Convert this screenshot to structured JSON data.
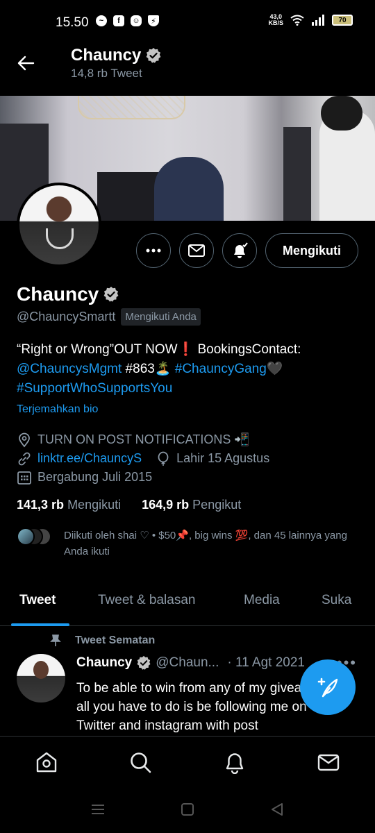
{
  "status_bar": {
    "time": "15.50",
    "net_speed_value": "43,0",
    "net_speed_unit": "KB/S",
    "battery": "70",
    "icons": [
      "messenger-icon",
      "facebook-icon",
      "app-icon",
      "shield-icon",
      "wifi-icon",
      "signal-icon",
      "battery-icon"
    ]
  },
  "header": {
    "name": "Chauncy",
    "tweet_count": "14,8 rb Tweet"
  },
  "profile": {
    "name": "Chauncy",
    "handle": "@ChauncySmartt",
    "follows_you": "Mengikuti Anda",
    "follow_button": "Mengikuti",
    "bio_part1": "“Right or Wrong”OUT NOW❗ BookingsContact: ",
    "bio_mention": "@ChauncysMgmt",
    "bio_part2": " #863🏝️ ",
    "bio_hashtag1": "#ChauncyGang",
    "bio_part3": "🖤 ",
    "bio_hashtag2": "#SupportWhoSupportsYou",
    "translate_bio": "Terjemahkan bio",
    "location": "TURN ON POST NOTIFICATIONS 📲",
    "website": "linktr.ee/ChauncyS",
    "birthday": "Lahir 15 Agustus",
    "joined": "Bergabung Juli 2015",
    "following_count": "141,3 rb",
    "following_label": "Mengikuti",
    "followers_count": "164,9 rb",
    "followers_label": "Pengikut",
    "followed_by": "Diikuti oleh shai ♡ • $50📌, big wins 💯, dan 45 lainnya yang Anda ikuti"
  },
  "tabs": [
    {
      "label": "Tweet",
      "active": true
    },
    {
      "label": "Tweet & balasan",
      "active": false
    },
    {
      "label": "Media",
      "active": false
    },
    {
      "label": "Suka",
      "active": false
    }
  ],
  "pinned_tweet": {
    "pinned_label": "Tweet Sematan",
    "name": "Chauncy",
    "handle": "@Chaun...",
    "date": "· 11 Agt 2021",
    "text": "To be able to win from any of my giveaways all you have to do is be following me on Twitter and instagram with post"
  },
  "colors": {
    "accent": "#1d9bf0",
    "background": "#000000",
    "secondary_text": "#8b98a5"
  }
}
